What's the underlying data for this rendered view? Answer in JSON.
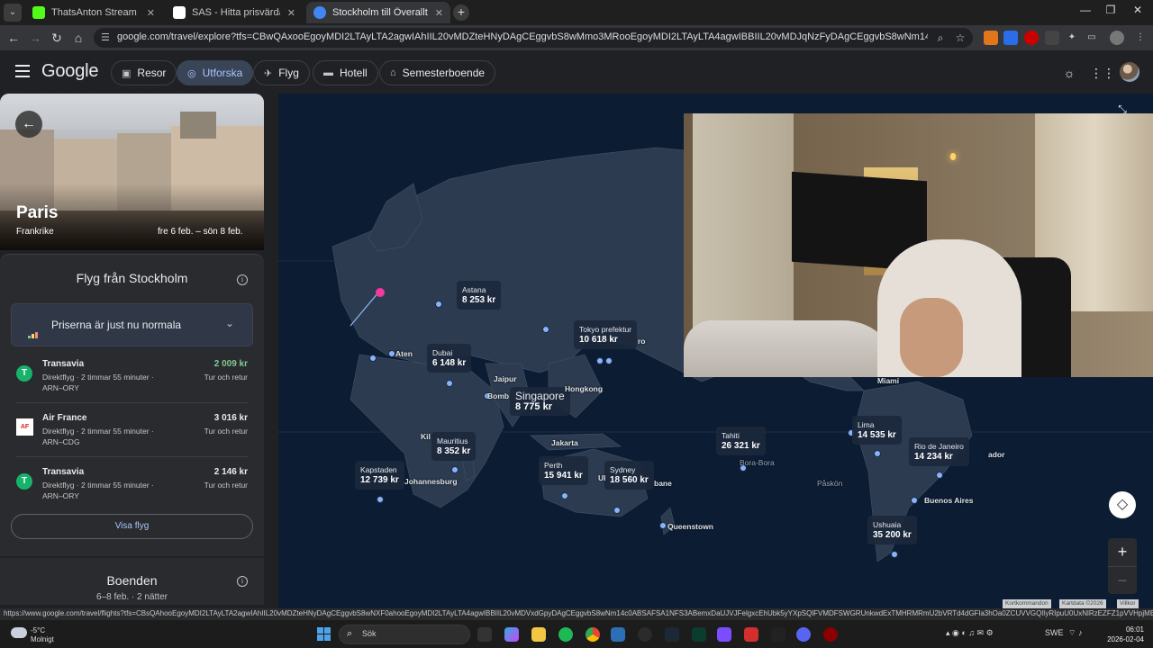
{
  "browser": {
    "tabs": [
      {
        "title": "ThatsAnton Stream - Watch Liv",
        "color": "#53fc18"
      },
      {
        "title": "SAS - Hitta prisvärda flyg – Bok",
        "color": "#ffffff"
      },
      {
        "title": "Stockholm till Överallt | Utforsk",
        "color": "#4285f4"
      }
    ],
    "url": "google.com/travel/explore?tfs=CBwQAxooEgoyMDI2LTAyLTA2agwIAhIIL20vMDZteHNyDAgCEggvbS8wMmo3MRooEgoyMDI2LTAyLTA4agwIBBIIL20vMDJqNzFyDAgCEggvbS8wNm14c0ABSAFwAYIBCwj________88mAE...",
    "status_url": "https://www.google.com/travel/flights?tfs=CBsQAhooEgoyMDI2LTAyLTA2agwIAhIIL20vMDZteHNyDAgCEggvbS8wNXF0ahooEgoyMDI2LTAyLTA4agwIBBIIL20vMDVxdGpyDAgCEggvbS8wNm14c0ABSAFSA1NFS3ABemxDaUJVJFelgxcEhUbk5yYXpSQlFVMDFSWGRUnkwdExTMHRMRmU2bVRTd4dGFla3hOa0ZCUVVGQlIyRIpuU0UxNlRzEZFZ1pVVHpjME5..."
  },
  "header": {
    "logo": "Google",
    "chips": [
      {
        "label": "Resor",
        "icon": "luggage-icon"
      },
      {
        "label": "Utforska",
        "icon": "explore-icon",
        "active": true
      },
      {
        "label": "Flyg",
        "icon": "plane-icon"
      },
      {
        "label": "Hotell",
        "icon": "bed-icon"
      },
      {
        "label": "Semesterboende",
        "icon": "house-icon"
      }
    ]
  },
  "destination": {
    "city": "Paris",
    "country": "Frankrike",
    "dates": "fre 6 feb. – sön 8 feb."
  },
  "flights": {
    "title": "Flyg från Stockholm",
    "price_status": "Priserna är just nu normala",
    "items": [
      {
        "airline": "Transavia",
        "meta": "Direktflyg · 2 timmar 55 minuter ·",
        "route": "ARN–ORY",
        "price": "2 009 kr",
        "trip": "Tur och retur",
        "logo": "T",
        "best": true
      },
      {
        "airline": "Air France",
        "meta": "Direktflyg · 2 timmar 55 minuter ·",
        "route": "ARN–CDG",
        "price": "3 016 kr",
        "trip": "Tur och retur",
        "logo": "AF"
      },
      {
        "airline": "Transavia",
        "meta": "Direktflyg · 2 timmar 55 minuter ·",
        "route": "ARN–ORY",
        "price": "2 146 kr",
        "trip": "Tur och retur",
        "logo": "T"
      }
    ],
    "show_button": "Visa flyg"
  },
  "stays": {
    "title": "Boenden",
    "subtitle": "6–8 feb. · 2 nätter"
  },
  "map": {
    "price_labels": [
      {
        "city": "Astana",
        "price": "8 253 kr"
      },
      {
        "city": "Tokyo prefektur",
        "price": "10 618 kr"
      },
      {
        "city": "Dubai",
        "price": "6 148 kr"
      },
      {
        "city": "Singapore",
        "price": "8 775 kr"
      },
      {
        "city": "Mauritius",
        "price": "8 352 kr"
      },
      {
        "city": "Kapstaden",
        "price": "12 739 kr"
      },
      {
        "city": "Perth",
        "price": "15 941 kr"
      },
      {
        "city": "Sydney",
        "price": "18 560 kr"
      },
      {
        "city": "Tahiti",
        "price": "26 321 kr"
      },
      {
        "city": "Lima",
        "price": "14 535 kr"
      },
      {
        "city": "Rio de Janeiro",
        "price": "14 234 kr"
      },
      {
        "city": "Ushuaia",
        "price": "35 200 kr"
      }
    ],
    "cities": [
      "Aten",
      "Jaipur",
      "Bomb",
      "Hongkong",
      "Jakarta",
      "Kil",
      "Johannesburg",
      "Queenstown",
      "Bora-Bora",
      "Påskön",
      "Buenos Aires",
      "Miami",
      "ador",
      "ro",
      "Ul",
      "bane"
    ],
    "attribution": [
      "Kortkommandon",
      "Kartdata ©2026",
      "Villkor"
    ]
  },
  "taskbar": {
    "temp": "-5°C",
    "condition": "Molnigt",
    "search": "Sök",
    "lang": "SWE",
    "time": "06:01",
    "date": "2026-02-04"
  }
}
